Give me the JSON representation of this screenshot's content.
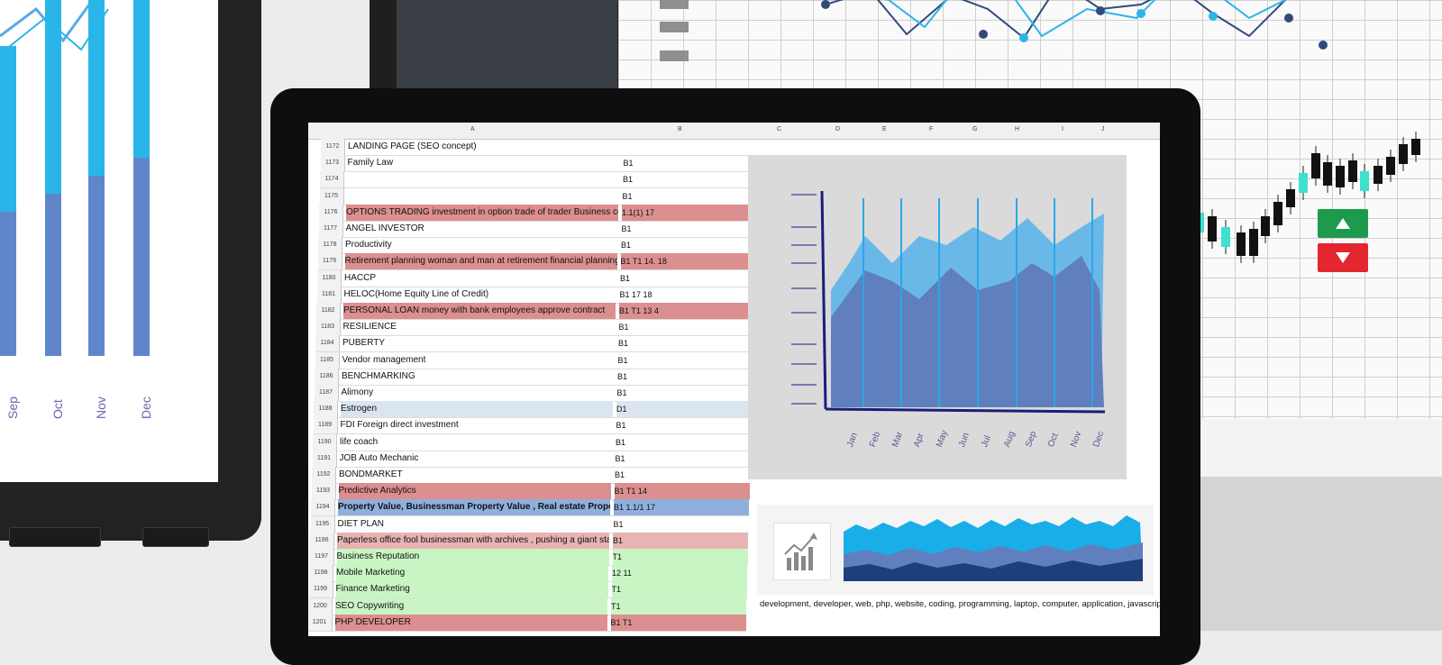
{
  "tablet": {
    "month_labels": [
      "Sep",
      "Oct",
      "Nov",
      "Dec"
    ],
    "bars": [
      {
        "month": "Sep",
        "upper": 0.46,
        "lower": 0.4
      },
      {
        "month": "Oct",
        "upper": 0.55,
        "lower": 0.45
      },
      {
        "month": "Nov",
        "upper": 0.65,
        "lower": 0.5
      },
      {
        "month": "Dec",
        "upper": 0.6,
        "lower": 0.55
      }
    ],
    "colors": {
      "upper": "#29b5e8",
      "lower": "#5f86c8"
    }
  },
  "monitor": {
    "trend_up_color": "#1e9a4d",
    "trend_down_color": "#e3262f",
    "icons": [
      "arrow-up-icon",
      "arrow-down-icon"
    ]
  },
  "spreadsheet": {
    "columns": [
      "A",
      "B",
      "C",
      "D",
      "E",
      "F",
      "G",
      "H",
      "I",
      "J"
    ],
    "rows": [
      {
        "num": "1172",
        "a": "LANDING PAGE (SEO concept)",
        "b": "",
        "fill": ""
      },
      {
        "num": "1173",
        "a": "Family Law",
        "b": "B1",
        "fill": ""
      },
      {
        "num": "1174",
        "a": "",
        "b": "B1",
        "fill": ""
      },
      {
        "num": "1175",
        "a": "",
        "b": "B1",
        "fill": ""
      },
      {
        "num": "1176",
        "a": "OPTIONS TRADING investment in option trade of trader Business concept ,Online Sto",
        "b": "1.1(1) 17",
        "fill": "#dc8f8f"
      },
      {
        "num": "1177",
        "a": "ANGEL INVESTOR",
        "b": "B1",
        "fill": ""
      },
      {
        "num": "1178",
        "a": "Productivity",
        "b": "B1",
        "fill": ""
      },
      {
        "num": "1179",
        "a": "Retirement planning woman and man at retirement financial planning with consultar",
        "b": "B1 T1 14. 18",
        "fill": "#dc8f8f"
      },
      {
        "num": "1180",
        "a": "HACCP",
        "b": "B1",
        "fill": ""
      },
      {
        "num": "1181",
        "a": "HELOC(Home Equity Line of Credit)",
        "b": "B1 17 18",
        "fill": ""
      },
      {
        "num": "1182",
        "a": "PERSONAL LOAN money with bank employees approve contract",
        "b": "B1 T1 13 4",
        "fill": "#dc8f8f"
      },
      {
        "num": "1183",
        "a": "RESILIENCE",
        "b": "B1",
        "fill": ""
      },
      {
        "num": "1184",
        "a": "PUBERTY",
        "b": "B1",
        "fill": ""
      },
      {
        "num": "1185",
        "a": "Vendor management",
        "b": "B1",
        "fill": ""
      },
      {
        "num": "1186",
        "a": "BENCHMARKING",
        "b": "B1",
        "fill": ""
      },
      {
        "num": "1187",
        "a": "Alimony",
        "b": "B1",
        "fill": ""
      },
      {
        "num": "1188",
        "a": "Estrogen",
        "b": "D1",
        "fill": "#dbe5f0"
      },
      {
        "num": "1189",
        "a": "FDI Foreign direct investment",
        "b": "B1",
        "fill": ""
      },
      {
        "num": "1190",
        "a": "life coach",
        "b": "B1",
        "fill": ""
      },
      {
        "num": "1191",
        "a": "JOB Auto Mechanic",
        "b": "B1",
        "fill": ""
      },
      {
        "num": "1192",
        "a": "BONDMARKET",
        "b": "B1",
        "fill": ""
      },
      {
        "num": "1193",
        "a": "Predictive Analytics",
        "b": "B1 T1 14",
        "fill": "#dc8f8f"
      },
      {
        "num": "1194",
        "a": "Property Value, Businessman Property Value , Real estate Property Value , How Mu",
        "b": "B1 1.1/1 17",
        "fill": "#8fb0dc",
        "bold": true
      },
      {
        "num": "1195",
        "a": "DIET PLAN",
        "b": "B1",
        "fill": ""
      },
      {
        "num": "1196",
        "a": "Paperless office fool businessman with archives , pushing a giant stack of documents",
        "b": "B1",
        "fill": "#e8b3b3"
      },
      {
        "num": "1197",
        "a": "Business Reputation",
        "b": "T1",
        "fill": "#c9f5c4"
      },
      {
        "num": "1198",
        "a": "Mobile Marketing",
        "b": "12 11",
        "fill": "#c9f5c4"
      },
      {
        "num": "1199",
        "a": "Finance Marketing",
        "b": "T1",
        "fill": "#c9f5c4"
      },
      {
        "num": "1200",
        "a": "SEO Copywriting",
        "b": "T1",
        "fill": "#c9f5c4"
      },
      {
        "num": "1201",
        "a": "PHP DEVELOPER",
        "b": "B1 T1",
        "fill": "#dc8f8f"
      }
    ],
    "keywords_text": "development, developer, web, php, website, coding, programming, laptop, computer, application, javascript, programmer, code, site,"
  },
  "laptop_chart": {
    "months": [
      "Jan",
      "Feb",
      "Mar",
      "Apr",
      "May",
      "Jun",
      "Jul",
      "Aug",
      "Sep",
      "Oct",
      "Nov",
      "Dec"
    ],
    "colors": {
      "back": "#6ab8e8",
      "front": "#5f7fbf",
      "axis": "#1c1c7a"
    }
  }
}
